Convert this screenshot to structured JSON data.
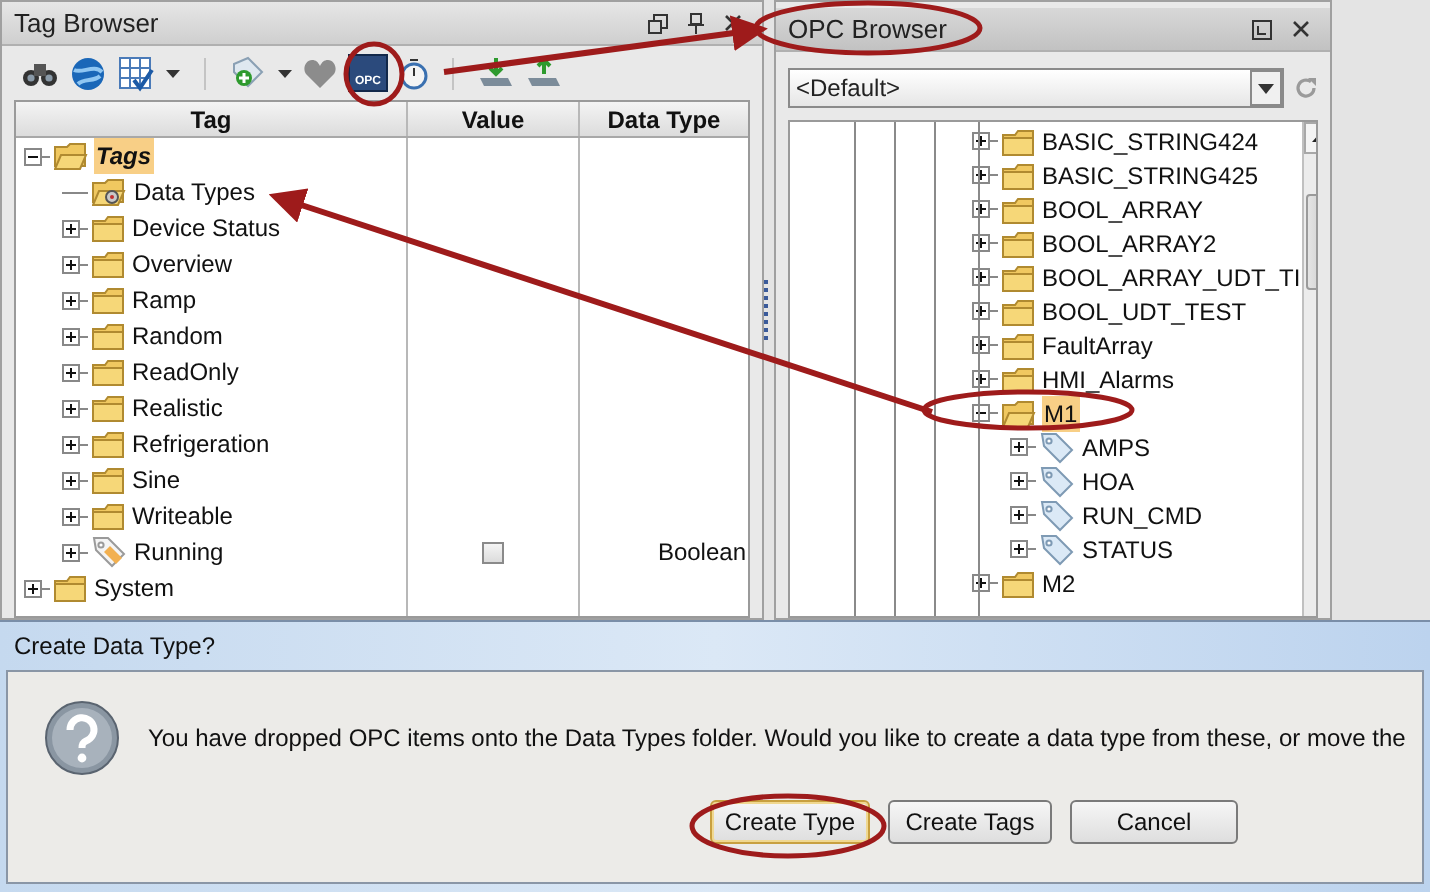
{
  "tag_browser": {
    "title": "Tag Browser",
    "opc_button_label": "OPC",
    "columns": [
      "Tag",
      "Value",
      "Data Type"
    ],
    "tree": [
      {
        "label": "Tags",
        "kind": "folder",
        "expanded": true,
        "selected": true,
        "children": [
          {
            "label": "Data Types",
            "kind": "types_folder",
            "selected": false
          },
          {
            "label": "Device Status",
            "kind": "folder",
            "expanded": false,
            "selected": false
          },
          {
            "label": "Overview",
            "kind": "folder",
            "expanded": false,
            "selected": false
          },
          {
            "label": "Ramp",
            "kind": "folder",
            "expanded": false,
            "selected": false
          },
          {
            "label": "Random",
            "kind": "folder",
            "expanded": false,
            "selected": false
          },
          {
            "label": "ReadOnly",
            "kind": "folder",
            "expanded": false,
            "selected": false
          },
          {
            "label": "Realistic",
            "kind": "folder",
            "expanded": false,
            "selected": false
          },
          {
            "label": "Refrigeration",
            "kind": "folder",
            "expanded": false,
            "selected": false
          },
          {
            "label": "Sine",
            "kind": "folder",
            "expanded": false,
            "selected": false
          },
          {
            "label": "Writeable",
            "kind": "folder",
            "expanded": false,
            "selected": false
          },
          {
            "label": "Running",
            "kind": "tag",
            "expanded": false,
            "selected": false,
            "value_checked": false,
            "data_type": "Boolean"
          }
        ]
      },
      {
        "label": "System",
        "kind": "folder",
        "expanded": false,
        "selected": false
      }
    ]
  },
  "opc_browser": {
    "title": "OPC Browser",
    "server": "<Default>",
    "tree": [
      {
        "label": "BASIC_STRING424",
        "kind": "folder",
        "expanded": false,
        "selected": false
      },
      {
        "label": "BASIC_STRING425",
        "kind": "folder",
        "expanded": false,
        "selected": false
      },
      {
        "label": "BOOL_ARRAY",
        "kind": "folder",
        "expanded": false,
        "selected": false
      },
      {
        "label": "BOOL_ARRAY2",
        "kind": "folder",
        "expanded": false,
        "selected": false
      },
      {
        "label": "BOOL_ARRAY_UDT_TI",
        "kind": "folder",
        "expanded": false,
        "selected": false
      },
      {
        "label": "BOOL_UDT_TEST",
        "kind": "folder",
        "expanded": false,
        "selected": false
      },
      {
        "label": "FaultArray",
        "kind": "folder",
        "expanded": false,
        "selected": false
      },
      {
        "label": "HMI_Alarms",
        "kind": "folder",
        "expanded": false,
        "selected": false
      },
      {
        "label": "M1",
        "kind": "folder",
        "expanded": true,
        "selected": true,
        "children": [
          {
            "label": "AMPS",
            "kind": "tag",
            "expanded": false,
            "selected": false
          },
          {
            "label": "HOA",
            "kind": "tag",
            "expanded": false,
            "selected": false
          },
          {
            "label": "RUN_CMD",
            "kind": "tag",
            "expanded": false,
            "selected": false
          },
          {
            "label": "STATUS",
            "kind": "tag",
            "expanded": false,
            "selected": false
          }
        ]
      },
      {
        "label": "M2",
        "kind": "folder",
        "expanded": false,
        "selected": false
      }
    ]
  },
  "dialog": {
    "title": "Create Data Type?",
    "message": "You have dropped OPC items onto the Data Types folder. Would you like to create a data type from these, or move the",
    "buttons": [
      {
        "label": "Create Type",
        "selected": true
      },
      {
        "label": "Create Tags",
        "selected": false
      },
      {
        "label": "Cancel",
        "selected": false
      }
    ]
  }
}
